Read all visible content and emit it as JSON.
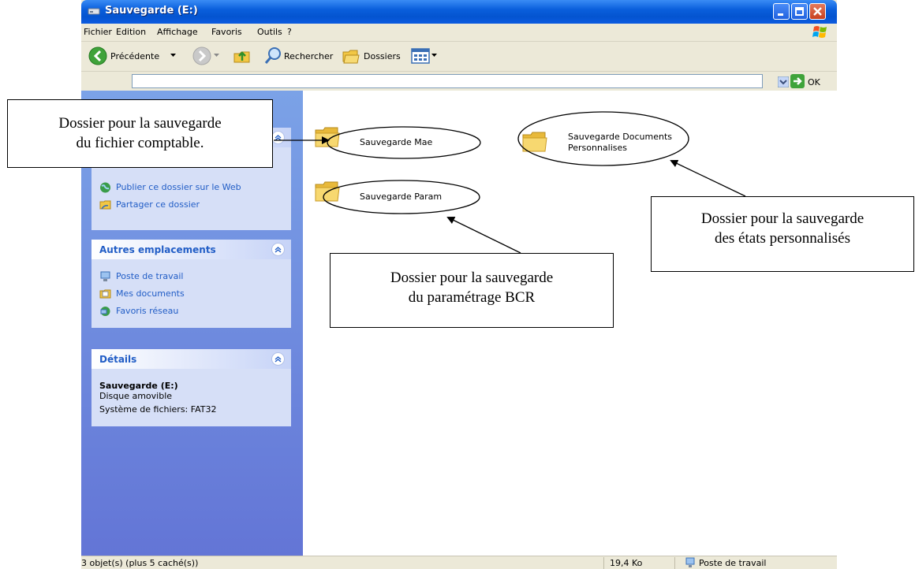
{
  "window": {
    "title": "Sauvegarde (E:)"
  },
  "menu": [
    "Fichier",
    "Edition",
    "Affichage",
    "Favoris",
    "Outils",
    "?"
  ],
  "toolbar": {
    "back_label": "Précédente",
    "search_label": "Rechercher",
    "folders_label": "Dossiers"
  },
  "address": {
    "go_label": "OK"
  },
  "sidebar": {
    "tasks": {
      "items": [
        {
          "label": "Publier ce dossier sur le Web",
          "icon": "globe-icon"
        },
        {
          "label": "Partager ce dossier",
          "icon": "share-folder-icon"
        }
      ]
    },
    "places": {
      "title": "Autres emplacements",
      "items": [
        {
          "label": "Poste de travail",
          "icon": "computer-icon"
        },
        {
          "label": "Mes documents",
          "icon": "documents-icon"
        },
        {
          "label": "Favoris réseau",
          "icon": "network-icon"
        }
      ]
    },
    "details": {
      "title": "Détails",
      "name": "Sauvegarde (E:)",
      "type": "Disque amovible",
      "filesystem": "Système de fichiers: FAT32"
    }
  },
  "folders": [
    {
      "name": "Sauvegarde Mae"
    },
    {
      "name": "Sauvegarde Param"
    },
    {
      "name_line1": "Sauvegarde Documents",
      "name_line2": "Personnalises"
    }
  ],
  "status": {
    "objects": "3 objet(s) (plus 5 caché(s))",
    "size": "19,4 Ko",
    "location": "Poste de travail"
  },
  "callouts": [
    {
      "line1": "Dossier pour la sauvegarde",
      "line2": "du fichier comptable."
    },
    {
      "line1": "Dossier pour la sauvegarde",
      "line2": "du paramétrage BCR"
    },
    {
      "line1": "Dossier pour la sauvegarde",
      "line2": "des états personnalisés"
    }
  ],
  "colors": {
    "xp_blue": "#0a5fdc",
    "sidebar_link": "#215dc6",
    "folder_yellow": "#f5d56b"
  }
}
